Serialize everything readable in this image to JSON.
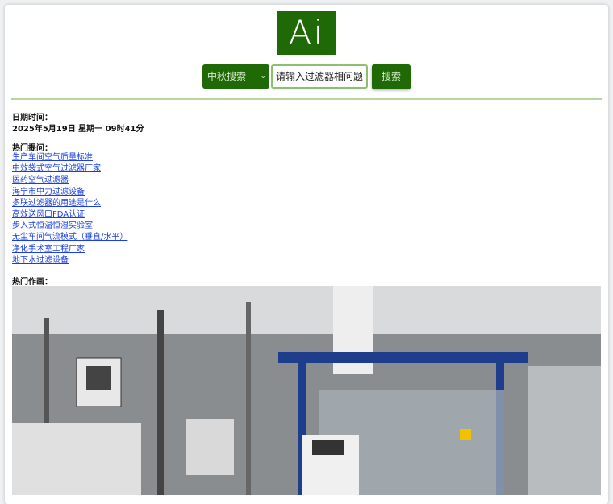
{
  "logo": {
    "text": "Ai",
    "color": "#1f6a06"
  },
  "search": {
    "engine_selected": "中秋搜索",
    "placeholder": "请输入过滤器相问题",
    "button_label": "搜索"
  },
  "datetime": {
    "label": "日期时间：",
    "value": "2025年5月19日 星期一 09时41分"
  },
  "hot_questions": {
    "label": "热门提问：",
    "items": [
      "生产车间空气质量标准",
      "中效袋式空气过滤器厂家",
      "医药空气过滤器",
      "海宁市中力过滤设备",
      "多联过滤器的用途是什么",
      "高效送风口FDA认证",
      "步入式恒温恒湿实验室",
      "无尘车间气流模式（垂直/水平）",
      "净化手术室工程厂家",
      "地下水过滤设备"
    ]
  },
  "hot_paintings": {
    "label": "热门作画："
  }
}
